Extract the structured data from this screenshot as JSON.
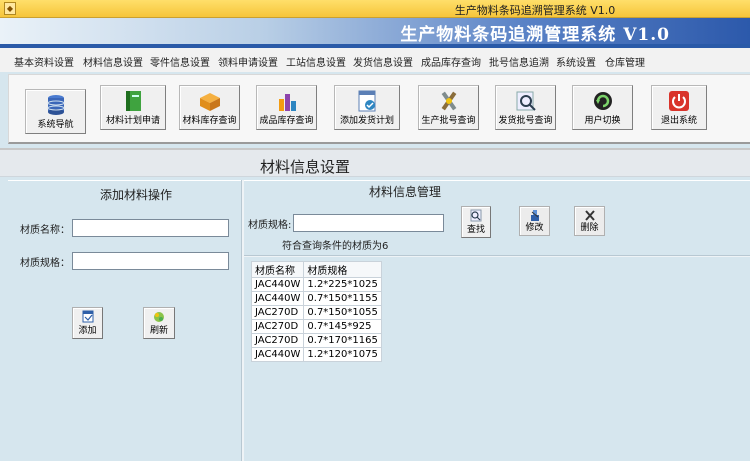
{
  "window": {
    "title": "生产物料条码追溯管理系统 V1.0"
  },
  "banner": {
    "title": "生产物料条码追溯管理系统 V1.0"
  },
  "menu": [
    "基本资料设置",
    "材料信息设置",
    "零件信息设置",
    "领料申请设置",
    "工站信息设置",
    "发货信息设置",
    "成品库存查询",
    "批号信息追溯",
    "系统设置",
    "仓库管理"
  ],
  "toolbar": [
    {
      "label": "系统导航",
      "icon": "database-icon"
    },
    {
      "label": "材料计划申请",
      "icon": "book-icon"
    },
    {
      "label": "材料库存查询",
      "icon": "box-icon"
    },
    {
      "label": "成品库存查询",
      "icon": "chart-icon"
    },
    {
      "label": "添加发货计划",
      "icon": "checklist-icon"
    },
    {
      "label": "生产批号查询",
      "icon": "tools-icon"
    },
    {
      "label": "发货批号查询",
      "icon": "magnifier-icon"
    },
    {
      "label": "用户切换",
      "icon": "refresh-user-icon"
    },
    {
      "label": "退出系统",
      "icon": "power-icon"
    }
  ],
  "page": {
    "title": "材料信息设置"
  },
  "left": {
    "header": "添加材料操作",
    "name_label": "材质名称：",
    "name_value": "",
    "spec_label": "材质规格：",
    "spec_value": "",
    "add_label": "添加",
    "refresh_label": "刷新"
  },
  "right": {
    "header": "材料信息管理",
    "search_label": "材质规格:",
    "search_value": "",
    "search_btn": "查找",
    "edit_btn": "修改",
    "delete_btn": "删除",
    "result_text": "符合查询条件的材质为6"
  },
  "table": {
    "columns": [
      "材质名称",
      "材质规格"
    ],
    "rows": [
      [
        "JAC440W",
        "1.2*225*1025"
      ],
      [
        "JAC440W",
        "0.7*150*1155"
      ],
      [
        "JAC270D",
        "0.7*150*1055"
      ],
      [
        "JAC270D",
        "0.7*145*925"
      ],
      [
        "JAC270D",
        "0.7*170*1165"
      ],
      [
        "JAC440W",
        "1.2*120*1075"
      ]
    ]
  },
  "colors": {
    "banner_blue": "#2c59ab",
    "panel_bg": "#d6e6ee",
    "titlebar": "#f6c53a"
  }
}
